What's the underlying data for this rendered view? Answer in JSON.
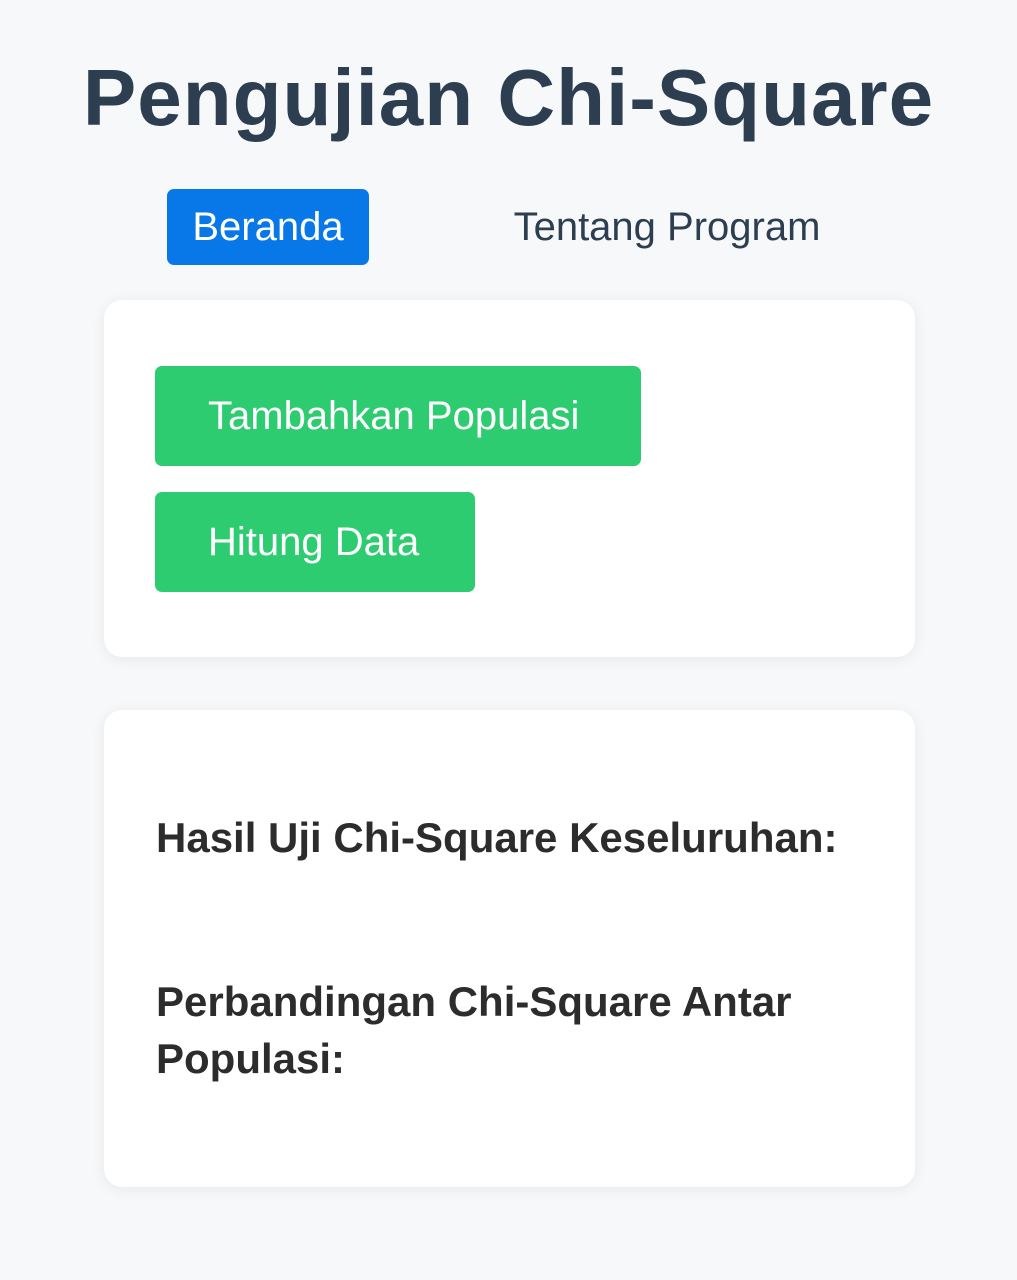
{
  "header": {
    "title": "Pengujian Chi-Square"
  },
  "nav": {
    "tabs": [
      {
        "label": "Beranda",
        "active": true
      },
      {
        "label": "Tentang Program",
        "active": false
      }
    ]
  },
  "actions": {
    "add_population_label": "Tambahkan Populasi",
    "calculate_label": "Hitung Data"
  },
  "results": {
    "overall_heading": "Hasil Uji Chi-Square Keseluruhan:",
    "comparison_heading": "Perbandingan Chi-Square Antar Populasi:"
  },
  "colors": {
    "background": "#f7f8f9",
    "title": "#2c3e50",
    "tab_active": "#0878e8",
    "button_green": "#2ecc71",
    "card": "#ffffff"
  }
}
